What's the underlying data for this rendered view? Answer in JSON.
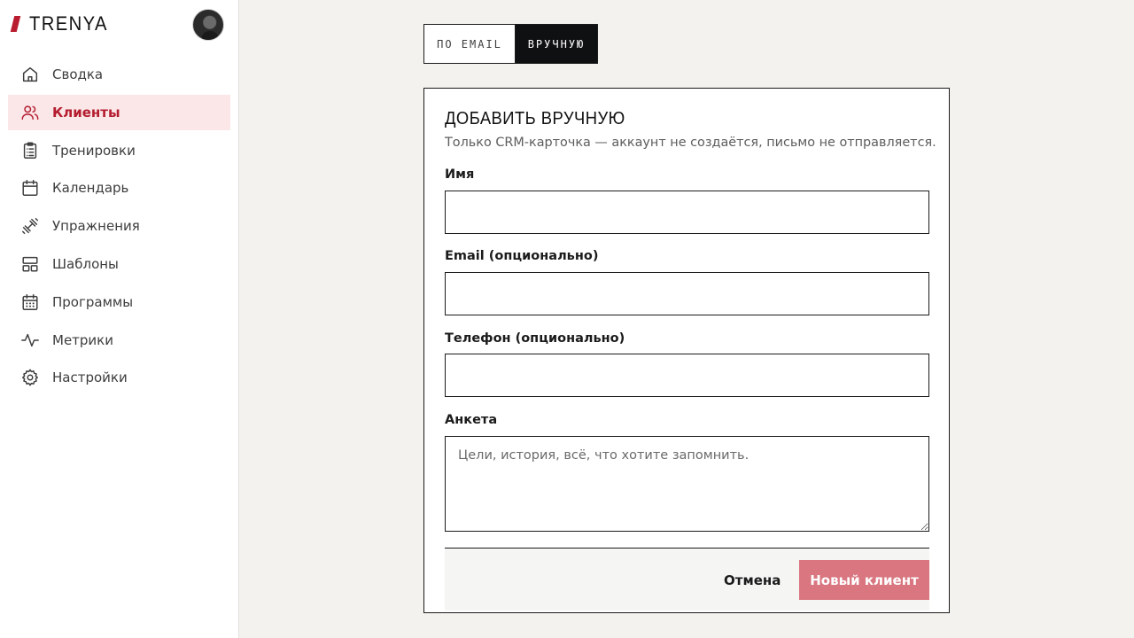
{
  "brand": {
    "name": "TRENYA",
    "accent_color": "#b91c2e"
  },
  "sidebar": {
    "items": [
      {
        "label": "Сводка",
        "icon": "home-icon"
      },
      {
        "label": "Клиенты",
        "icon": "users-icon",
        "active": true
      },
      {
        "label": "Тренировки",
        "icon": "clipboard-icon"
      },
      {
        "label": "Календарь",
        "icon": "calendar-icon"
      },
      {
        "label": "Упражнения",
        "icon": "dumbbell-icon"
      },
      {
        "label": "Шаблоны",
        "icon": "layout-icon"
      },
      {
        "label": "Программы",
        "icon": "calendar-grid-icon"
      },
      {
        "label": "Метрики",
        "icon": "activity-icon"
      },
      {
        "label": "Настройки",
        "icon": "gear-icon"
      }
    ]
  },
  "tabs": {
    "by_email": "ПО EMAIL",
    "manual": "ВРУЧНУЮ",
    "active": "manual"
  },
  "form": {
    "title": "ДОБАВИТЬ ВРУЧНУЮ",
    "subtitle": "Только CRM-карточка — аккаунт не создаётся, письмо не отправляется.",
    "name_label": "Имя",
    "name_value": "",
    "email_label": "Email (опционально)",
    "email_value": "",
    "phone_label": "Телефон (опционально)",
    "phone_value": "",
    "notes_label": "Анкета",
    "notes_placeholder": "Цели, история, всё, что хотите запомнить.",
    "cancel_label": "Отмена",
    "submit_label": "Новый клиент"
  },
  "colors": {
    "active_bg": "#fbe6e8",
    "active_text": "#b31d2f",
    "primary_button": "#d97680"
  }
}
